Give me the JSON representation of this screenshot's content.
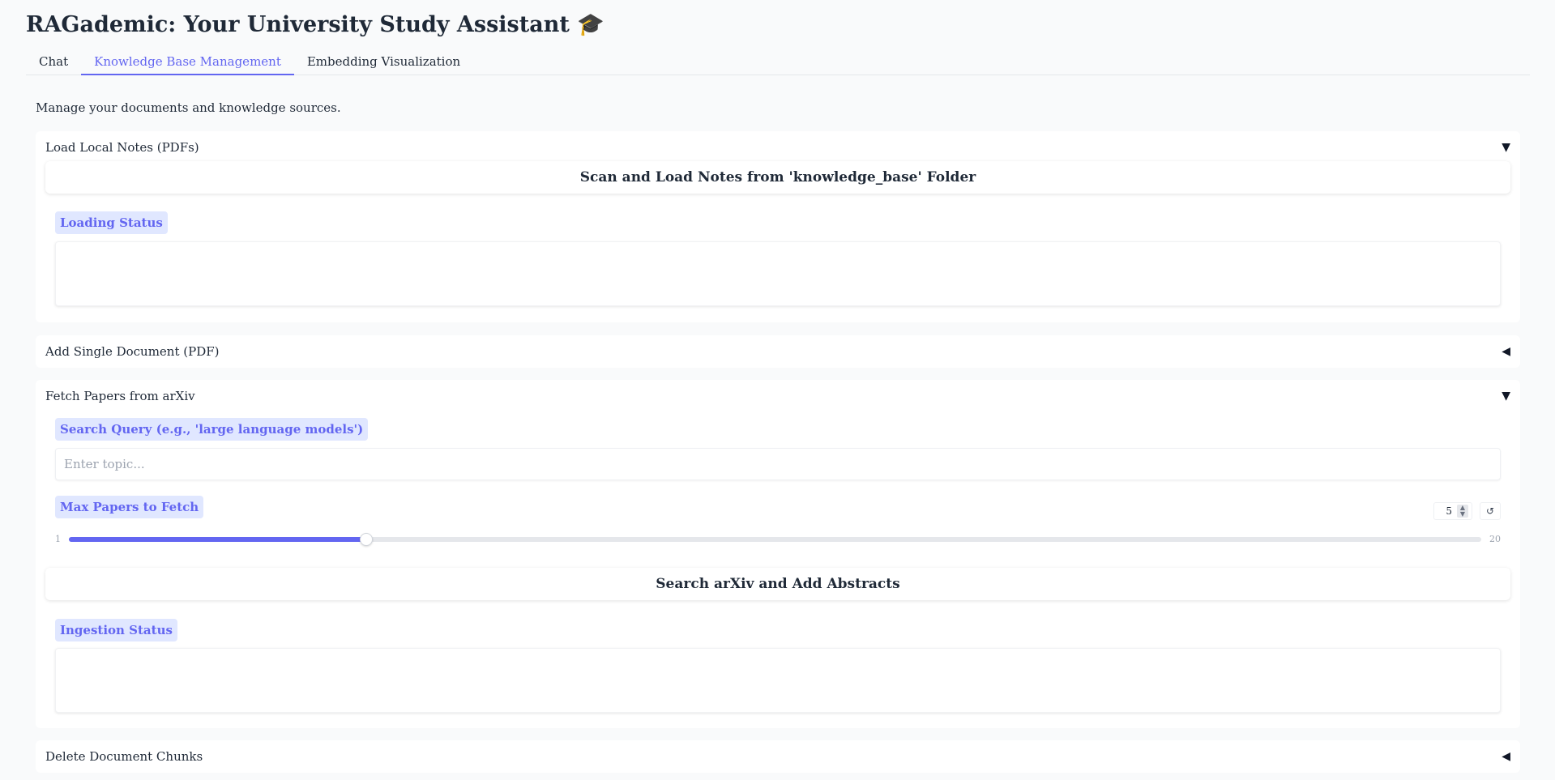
{
  "app": {
    "title": "RAGademic: Your University Study Assistant 🎓"
  },
  "tabs": [
    {
      "label": "Chat",
      "active": false
    },
    {
      "label": "Knowledge Base Management",
      "active": true
    },
    {
      "label": "Embedding Visualization",
      "active": false
    }
  ],
  "page": {
    "subtitle": "Manage your documents and knowledge sources."
  },
  "local_notes": {
    "header": "Load Local Notes (PDFs)",
    "arrow": "▼",
    "expanded": true,
    "button_label": "Scan and Load Notes from 'knowledge_base' Folder",
    "status_label": "Loading Status",
    "status_value": ""
  },
  "single_doc": {
    "header": "Add Single Document (PDF)",
    "arrow": "◀",
    "expanded": false
  },
  "arxiv": {
    "header": "Fetch Papers from arXiv",
    "arrow": "▼",
    "expanded": true,
    "query_label": "Search Query (e.g., 'large language models')",
    "query_placeholder": "Enter topic...",
    "query_value": "",
    "max_label": "Max Papers to Fetch",
    "max_value": 5,
    "max_min": 1,
    "max_max": 20,
    "stepper_icon": "updown-icon",
    "reset_icon": "↺",
    "button_label": "Search arXiv and Add Abstracts",
    "status_label": "Ingestion Status",
    "status_value": ""
  },
  "delete_chunks": {
    "header": "Delete Document Chunks",
    "arrow": "◀",
    "expanded": false
  },
  "colors": {
    "accent": "#6366f1",
    "chip_bg": "#e0e7ff",
    "background": "#f9fafb"
  }
}
